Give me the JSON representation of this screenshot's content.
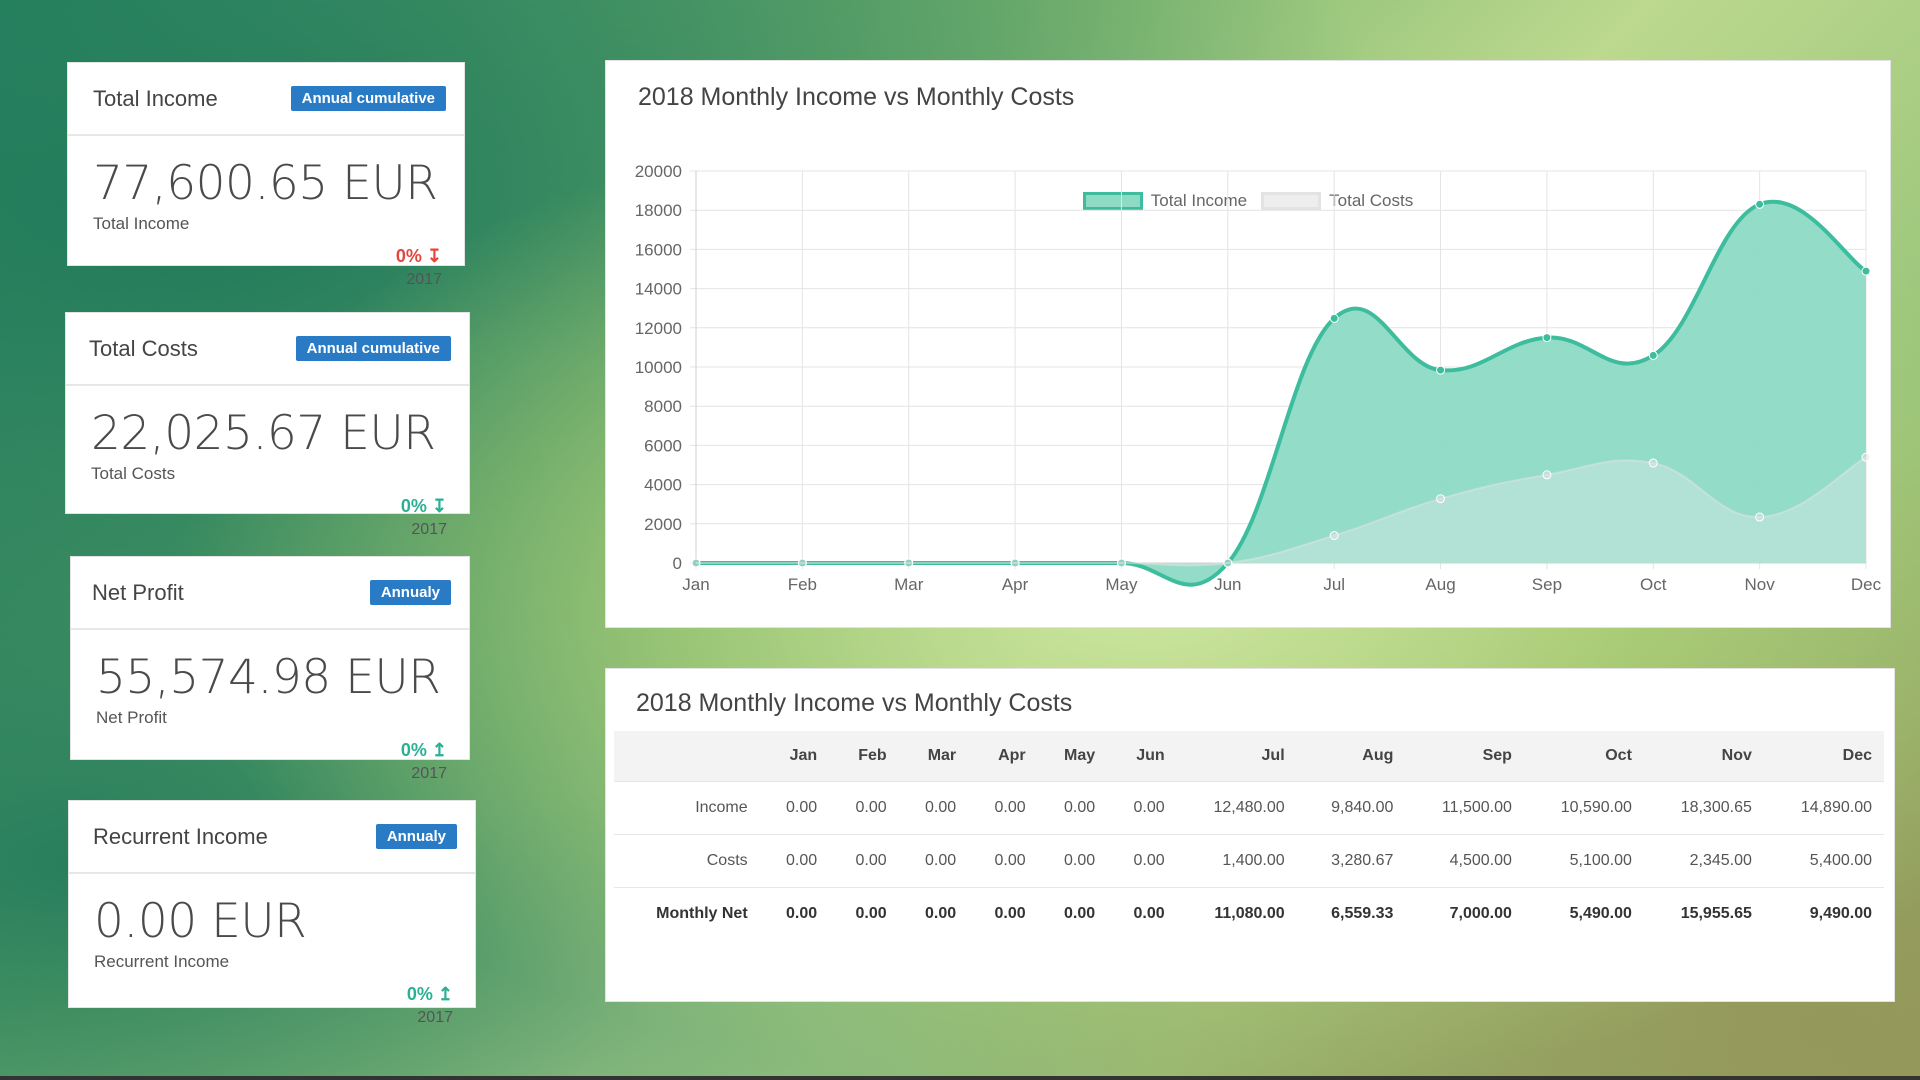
{
  "stats": [
    {
      "title": "Total Income",
      "badge": "Annual cumulative",
      "value": "77,600.65 EUR",
      "label": "Total Income",
      "pct": "0% ↧",
      "year": "2017"
    },
    {
      "title": "Total Costs",
      "badge": "Annual cumulative",
      "value": "22,025.67 EUR",
      "label": "Total Costs",
      "pct": "0% ↧",
      "year": "2017"
    },
    {
      "title": "Net Profit",
      "badge": "Annualy",
      "value": "55,574.98 EUR",
      "label": "Net Profit",
      "pct": "0% ↥",
      "year": "2017"
    },
    {
      "title": "Recurrent Income",
      "badge": "Annualy",
      "value": "0.00 EUR",
      "label": "Recurrent Income",
      "pct": "0% ↥",
      "year": "2017"
    }
  ],
  "chart_panel": {
    "title": "2018 Monthly Income vs Monthly Costs"
  },
  "chart_data": {
    "type": "area",
    "title": "2018 Monthly Income vs Monthly Costs",
    "categories": [
      "Jan",
      "Feb",
      "Mar",
      "Apr",
      "May",
      "Jun",
      "Jul",
      "Aug",
      "Sep",
      "Oct",
      "Nov",
      "Dec"
    ],
    "series": [
      {
        "name": "Total Income",
        "values": [
          0,
          0,
          0,
          0,
          0,
          0,
          12480,
          9840,
          11500,
          10590,
          18300.65,
          14890
        ],
        "color": "#3dbd9e",
        "fill": "#8ddac5"
      },
      {
        "name": "Total Costs",
        "values": [
          0,
          0,
          0,
          0,
          0,
          0,
          1400,
          3280.67,
          4500,
          5100,
          2345,
          5400
        ],
        "color": "#e3e3e3",
        "fill": "#eeeeee"
      }
    ],
    "ylim": [
      0,
      20000
    ],
    "yticks": [
      0,
      2000,
      4000,
      6000,
      8000,
      10000,
      12000,
      14000,
      16000,
      18000,
      20000
    ],
    "legend": "top-center",
    "grid": true
  },
  "table_panel": {
    "title": "2018 Monthly Income vs Monthly Costs",
    "headers": [
      "",
      "Jan",
      "Feb",
      "Mar",
      "Apr",
      "May",
      "Jun",
      "Jul",
      "Aug",
      "Sep",
      "Oct",
      "Nov",
      "Dec"
    ],
    "rows": [
      {
        "label": "Income",
        "cells": [
          "0.00",
          "0.00",
          "0.00",
          "0.00",
          "0.00",
          "0.00",
          "12,480.00",
          "9,840.00",
          "11,500.00",
          "10,590.00",
          "18,300.65",
          "14,890.00"
        ]
      },
      {
        "label": "Costs",
        "cells": [
          "0.00",
          "0.00",
          "0.00",
          "0.00",
          "0.00",
          "0.00",
          "1,400.00",
          "3,280.67",
          "4,500.00",
          "5,100.00",
          "2,345.00",
          "5,400.00"
        ]
      },
      {
        "label": "Monthly Net",
        "cells": [
          "0.00",
          "0.00",
          "0.00",
          "0.00",
          "0.00",
          "0.00",
          "11,080.00",
          "6,559.33",
          "7,000.00",
          "5,490.00",
          "15,955.65",
          "9,490.00"
        ]
      }
    ]
  }
}
